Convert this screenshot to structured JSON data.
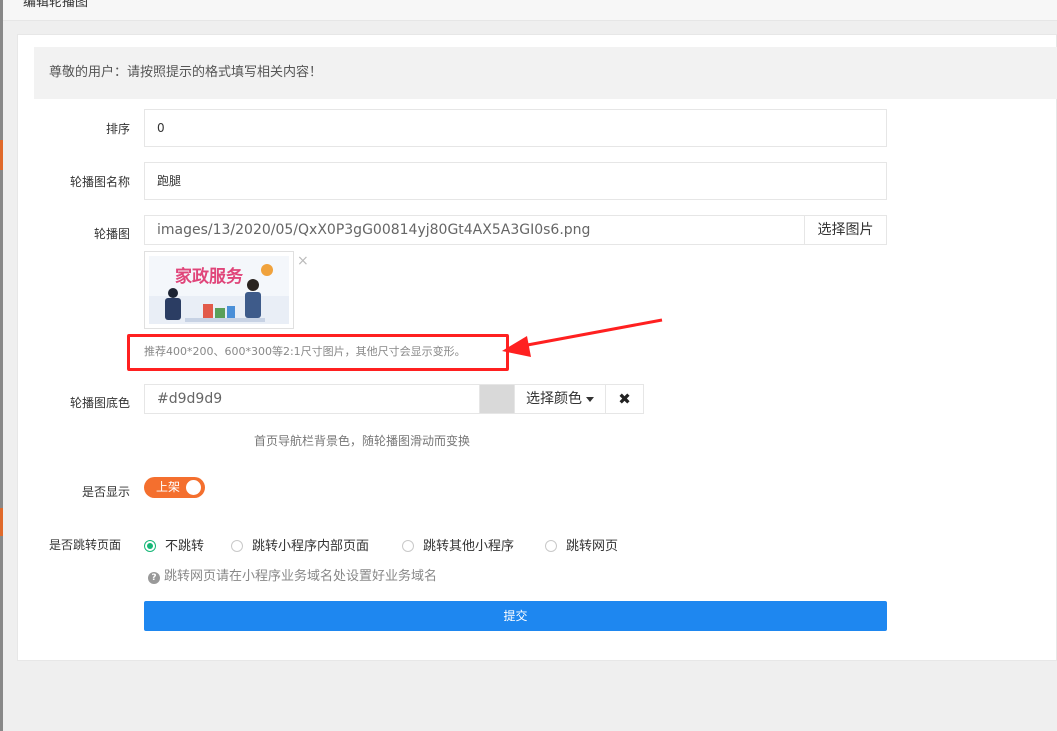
{
  "window": {
    "title": "编辑轮播图"
  },
  "notice": "尊敬的用户：请按照提示的格式填写相关内容！",
  "form": {
    "sort": {
      "label": "排序",
      "value": "0"
    },
    "name": {
      "label": "轮播图名称",
      "value": "跑腿"
    },
    "image": {
      "label": "轮播图",
      "path": "images/13/2020/05/QxX0P3gG00814yj80Gt4AX5A3GI0s6.png",
      "pick_label": "选择图片",
      "thumbnail_text": "家政服务",
      "remove_symbol": "×",
      "hint": "推荐400*200、600*300等2:1尺寸图片，其他尺寸会显示变形。"
    },
    "bg_color": {
      "label": "轮播图底色",
      "value": "#d9d9d9",
      "pick_label": "选择颜色",
      "clear_symbol": "✖",
      "hint": "首页导航栏背景色，随轮播图滑动而变换"
    },
    "display": {
      "label": "是否显示",
      "switch_text": "上架",
      "on": true
    },
    "jump": {
      "label": "是否跳转页面",
      "options": [
        "不跳转",
        "跳转小程序内部页面",
        "跳转其他小程序",
        "跳转网页"
      ],
      "selected_index": 0,
      "hint": "跳转网页请在小程序业务域名处设置好业务域名"
    },
    "submit_label": "提交"
  },
  "colors": {
    "accent": "#1e87f0",
    "switch": "#f46f2e",
    "radio": "#16b777",
    "annotation": "#ff2020"
  }
}
